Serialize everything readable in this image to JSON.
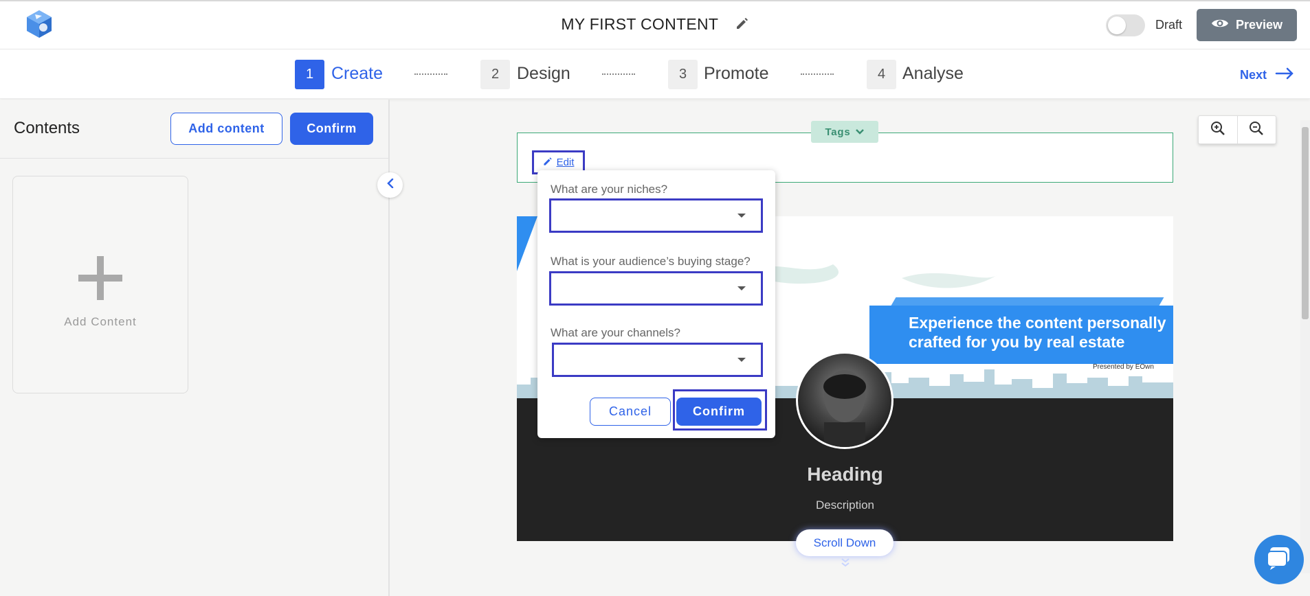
{
  "header": {
    "title": "MY FIRST CONTENT",
    "draft_label": "Draft",
    "preview_label": "Preview"
  },
  "steps": [
    {
      "num": "1",
      "label": "Create"
    },
    {
      "num": "2",
      "label": "Design"
    },
    {
      "num": "3",
      "label": "Promote"
    },
    {
      "num": "4",
      "label": "Analyse"
    }
  ],
  "next_label": "Next",
  "sidebar": {
    "title": "Contents",
    "add_content_button": "Add content",
    "confirm_button": "Confirm",
    "add_card_label": "Add Content"
  },
  "tags": {
    "label": "Tags",
    "edit_label": "Edit"
  },
  "popup": {
    "q1": "What are your niches?",
    "q2": "What is your audience’s buying stage?",
    "q3": "What are your channels?",
    "cancel": "Cancel",
    "confirm": "Confirm"
  },
  "preview_page": {
    "banner_text": "Experience the content personally crafted for you by real estate",
    "presented_by": "Presented by EOwn",
    "heading": "Heading",
    "description": "Description",
    "scroll_down": "Scroll Down"
  },
  "colors": {
    "primary": "#2f63e8",
    "highlight": "#3b3bc4",
    "tags_green": "#3aa876",
    "banner_blue": "#2f8ef0",
    "dark_bg": "#232323"
  }
}
